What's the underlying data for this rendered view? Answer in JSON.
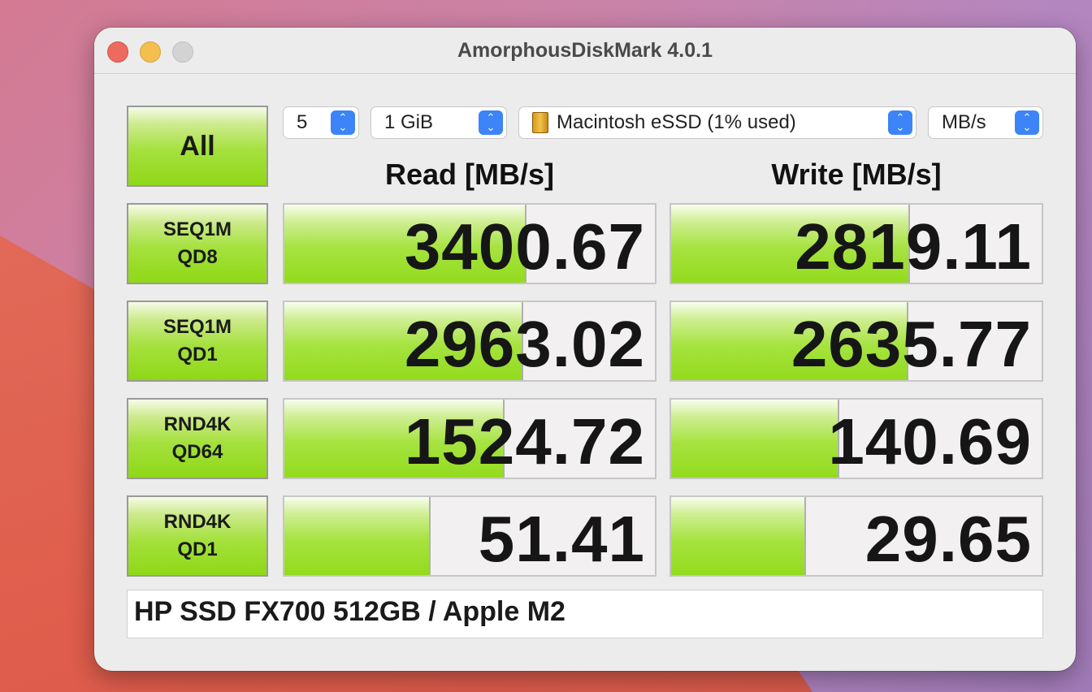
{
  "window": {
    "title": "AmorphousDiskMark 4.0.1"
  },
  "controls": {
    "all_label": "All",
    "count": "5",
    "size": "1 GiB",
    "drive": "Macintosh eSSD (1% used)",
    "unit": "MB/s"
  },
  "headers": {
    "read": "Read [MB/s]",
    "write": "Write [MB/s]"
  },
  "tests": [
    {
      "line1": "SEQ1M",
      "line2": "QD8",
      "read": "3400.67",
      "read_fill": 0.65,
      "write": "2819.11",
      "write_fill": 0.64
    },
    {
      "line1": "SEQ1M",
      "line2": "QD1",
      "read": "2963.02",
      "read_fill": 0.64,
      "write": "2635.77",
      "write_fill": 0.635
    },
    {
      "line1": "RND4K",
      "line2": "QD64",
      "read": "1524.72",
      "read_fill": 0.59,
      "write": "140.69",
      "write_fill": 0.45
    },
    {
      "line1": "RND4K",
      "line2": "QD1",
      "read": "51.41",
      "read_fill": 0.39,
      "write": "29.65",
      "write_fill": 0.36
    }
  ],
  "comment": "HP SSD FX700 512GB / Apple M2",
  "colors": {
    "bar_green": "#93db1d",
    "stepper_blue": "#3c84f7",
    "close": "#ed6a5e",
    "minimize": "#f5bf4f"
  },
  "icons": [
    "close-icon",
    "minimize-icon",
    "zoom-icon",
    "chevron-updown-icon",
    "external-drive-icon"
  ]
}
